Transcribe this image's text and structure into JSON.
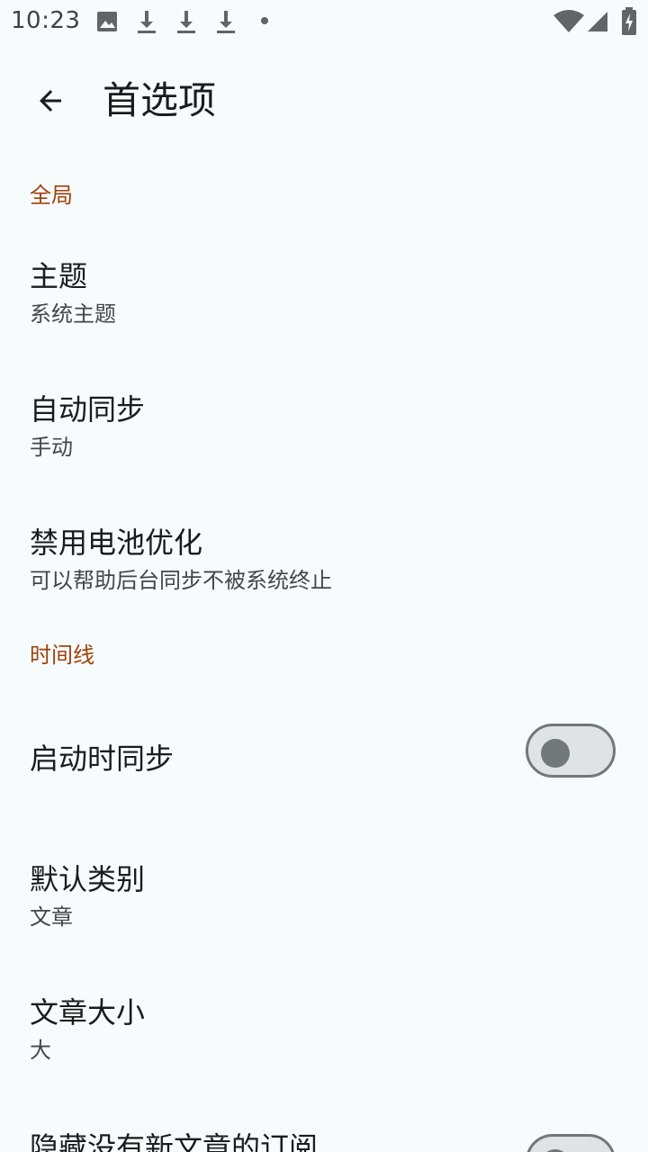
{
  "status_bar": {
    "time": "10:23"
  },
  "app_bar": {
    "title": "首选项",
    "back_icon": "arrow-back-icon"
  },
  "sections": {
    "global": {
      "header": "全局",
      "theme": {
        "title": "主题",
        "summary": "系统主题"
      },
      "auto_sync": {
        "title": "自动同步",
        "summary": "手动"
      },
      "battery": {
        "title": "禁用电池优化",
        "summary": "可以帮助后台同步不被系统终止"
      }
    },
    "timeline": {
      "header": "时间线",
      "sync_on_start": {
        "title": "启动时同步",
        "enabled": false
      },
      "default_category": {
        "title": "默认类别",
        "summary": "文章"
      },
      "article_size": {
        "title": "文章大小",
        "summary": "大"
      },
      "hide_empty": {
        "title": "隐藏没有新文章的订阅",
        "enabled": false
      }
    }
  },
  "colors": {
    "background": "#f6fbfd",
    "accent": "#a0420a",
    "switch_outline": "#70787c"
  }
}
